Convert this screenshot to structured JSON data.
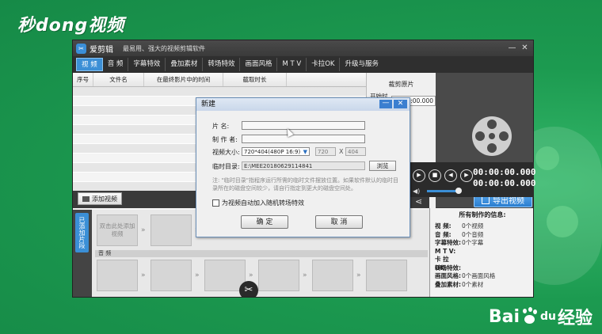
{
  "watermark": {
    "top_logo": "秒dong视频",
    "baidu": "Bai",
    "baidu_du": "du",
    "baidu_suffix": "经验"
  },
  "app": {
    "name": "爱剪辑",
    "slogan": "最易用、强大的视频剪辑软件",
    "window_controls": {
      "minimize": "—",
      "close": "✕"
    }
  },
  "menu": [
    {
      "label": "视 频",
      "active": true
    },
    {
      "label": "音 频"
    },
    {
      "label": "字幕特效"
    },
    {
      "label": "叠加素材"
    },
    {
      "label": "转场特效"
    },
    {
      "label": "画面风格"
    },
    {
      "label": "M T V"
    },
    {
      "label": "卡拉OK"
    },
    {
      "label": "升级与服务"
    }
  ],
  "clip_table": {
    "columns": [
      "序号",
      "文件名",
      "在最终影片中的时间",
      "截取时长"
    ]
  },
  "cut_panel": {
    "title": "裁剪原片",
    "start_label": "开始时间:",
    "start_value": "00:00:00.000"
  },
  "player": {
    "time_current": "00:00:00.000",
    "time_total": "00:00:00.000",
    "export_label": "导出视频"
  },
  "bottom": {
    "add_video": "添加视频",
    "tab_added": "已添加片段",
    "first_slot": "双击此处添加视频",
    "audio_label": "音 频"
  },
  "info_panel": {
    "title": "所有制作的信息:",
    "rows": [
      {
        "label": "视 频:",
        "value": "0个视频"
      },
      {
        "label": "音 频:",
        "value": "0个音频"
      },
      {
        "label": "字幕特效:",
        "value": "0个字幕"
      },
      {
        "label": "M T V:",
        "value": ""
      },
      {
        "label": "卡 拉 OK:",
        "value": ""
      },
      {
        "label": "转场特效:",
        "value": ""
      },
      {
        "label": "画面风格:",
        "value": "0个画面风格"
      },
      {
        "label": "叠加素材:",
        "value": "0个素材"
      }
    ]
  },
  "dialog": {
    "title": "新建",
    "title_label": "片 名:",
    "author_label": "制 作 者:",
    "size_label": "视频大小:",
    "size_value": "720*404(480P 16:9)",
    "width_value": "720",
    "times_sign": "X",
    "height_value": "404",
    "temp_label": "临时目录:",
    "temp_value": "E:\\MEE20180629114841",
    "browse_label": "浏览",
    "note": "注: \"临时目录\"指程序运行所需的临时文件摆放位置。如果软件默认的临时目录所在的磁盘空间较少，请自行指定到更大的磁盘空间处。",
    "checkbox_label": "为视频自动加入随机转场特效",
    "ok_label": "确 定",
    "cancel_label": "取 消"
  }
}
